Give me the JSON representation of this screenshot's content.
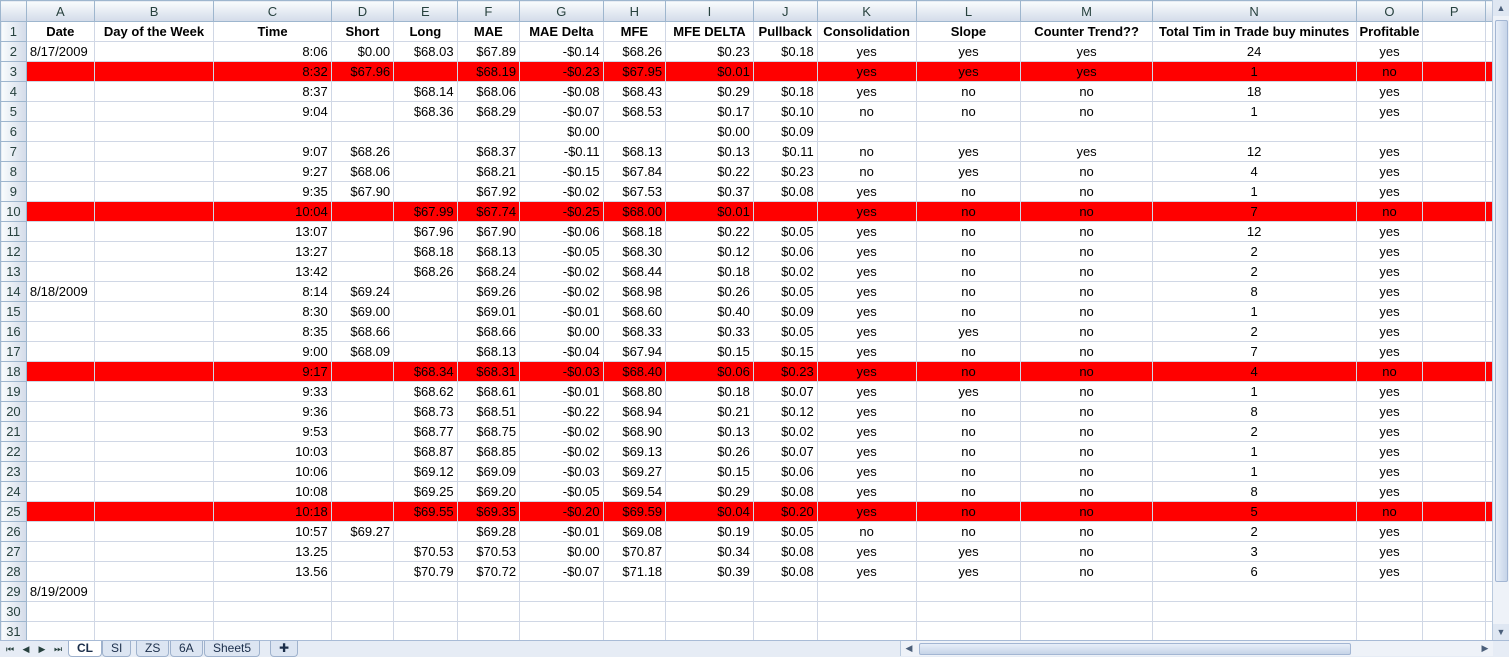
{
  "columns": [
    "A",
    "B",
    "C",
    "D",
    "E",
    "F",
    "G",
    "H",
    "I",
    "J",
    "K",
    "L",
    "M",
    "N",
    "O",
    "P"
  ],
  "rows": [
    {
      "n": "1",
      "hl": false,
      "cells": [
        "Date",
        "Day of the Week",
        "Time",
        "Short",
        "Long",
        "MAE",
        "MAE Delta",
        "MFE",
        "MFE DELTA",
        "Pullback",
        "Consolidation",
        "Slope",
        "Counter Trend??",
        "Total Tim in Trade buy minutes",
        "Profitable",
        ""
      ]
    },
    {
      "n": "2",
      "hl": false,
      "cells": [
        "8/17/2009",
        "",
        "8:06",
        "$0.00",
        "$68.03",
        "$67.89",
        "-$0.14",
        "$68.26",
        "$0.23",
        "$0.18",
        "yes",
        "yes",
        "yes",
        "24",
        "yes",
        ""
      ]
    },
    {
      "n": "3",
      "hl": true,
      "cells": [
        "",
        "",
        "8:32",
        "$67.96",
        "",
        "$68.19",
        "-$0.23",
        "$67.95",
        "$0.01",
        "",
        "yes",
        "yes",
        "yes",
        "1",
        "no",
        ""
      ]
    },
    {
      "n": "4",
      "hl": false,
      "cells": [
        "",
        "",
        "8:37",
        "",
        "$68.14",
        "$68.06",
        "-$0.08",
        "$68.43",
        "$0.29",
        "$0.18",
        "yes",
        "no",
        "no",
        "18",
        "yes",
        ""
      ]
    },
    {
      "n": "5",
      "hl": false,
      "cells": [
        "",
        "",
        "9:04",
        "",
        "$68.36",
        "$68.29",
        "-$0.07",
        "$68.53",
        "$0.17",
        "$0.10",
        "no",
        "no",
        "no",
        "1",
        "yes",
        ""
      ]
    },
    {
      "n": "6",
      "hl": false,
      "cells": [
        "",
        "",
        "",
        "",
        "",
        "",
        "$0.00",
        "",
        "$0.00",
        "$0.09",
        "",
        "",
        "",
        "",
        "",
        ""
      ]
    },
    {
      "n": "7",
      "hl": false,
      "cells": [
        "",
        "",
        "9:07",
        "$68.26",
        "",
        "$68.37",
        "-$0.11",
        "$68.13",
        "$0.13",
        "$0.11",
        "no",
        "yes",
        "yes",
        "12",
        "yes",
        ""
      ]
    },
    {
      "n": "8",
      "hl": false,
      "cells": [
        "",
        "",
        "9:27",
        "$68.06",
        "",
        "$68.21",
        "-$0.15",
        "$67.84",
        "$0.22",
        "$0.23",
        "no",
        "yes",
        "no",
        "4",
        "yes",
        ""
      ]
    },
    {
      "n": "9",
      "hl": false,
      "cells": [
        "",
        "",
        "9:35",
        "$67.90",
        "",
        "$67.92",
        "-$0.02",
        "$67.53",
        "$0.37",
        "$0.08",
        "yes",
        "no",
        "no",
        "1",
        "yes",
        ""
      ]
    },
    {
      "n": "10",
      "hl": true,
      "cells": [
        "",
        "",
        "10:04",
        "",
        "$67.99",
        "$67.74",
        "-$0.25",
        "$68.00",
        "$0.01",
        "",
        "yes",
        "no",
        "no",
        "7",
        "no",
        ""
      ]
    },
    {
      "n": "11",
      "hl": false,
      "cells": [
        "",
        "",
        "13:07",
        "",
        "$67.96",
        "$67.90",
        "-$0.06",
        "$68.18",
        "$0.22",
        "$0.05",
        "yes",
        "no",
        "no",
        "12",
        "yes",
        ""
      ]
    },
    {
      "n": "12",
      "hl": false,
      "cells": [
        "",
        "",
        "13:27",
        "",
        "$68.18",
        "$68.13",
        "-$0.05",
        "$68.30",
        "$0.12",
        "$0.06",
        "yes",
        "no",
        "no",
        "2",
        "yes",
        ""
      ]
    },
    {
      "n": "13",
      "hl": false,
      "cells": [
        "",
        "",
        "13:42",
        "",
        "$68.26",
        "$68.24",
        "-$0.02",
        "$68.44",
        "$0.18",
        "$0.02",
        "yes",
        "no",
        "no",
        "2",
        "yes",
        ""
      ]
    },
    {
      "n": "14",
      "hl": false,
      "cells": [
        "8/18/2009",
        "",
        "8:14",
        "$69.24",
        "",
        "$69.26",
        "-$0.02",
        "$68.98",
        "$0.26",
        "$0.05",
        "yes",
        "no",
        "no",
        "8",
        "yes",
        ""
      ]
    },
    {
      "n": "15",
      "hl": false,
      "cells": [
        "",
        "",
        "8:30",
        "$69.00",
        "",
        "$69.01",
        "-$0.01",
        "$68.60",
        "$0.40",
        "$0.09",
        "yes",
        "no",
        "no",
        "1",
        "yes",
        ""
      ]
    },
    {
      "n": "16",
      "hl": false,
      "cells": [
        "",
        "",
        "8:35",
        "$68.66",
        "",
        "$68.66",
        "$0.00",
        "$68.33",
        "$0.33",
        "$0.05",
        "yes",
        "yes",
        "no",
        "2",
        "yes",
        ""
      ]
    },
    {
      "n": "17",
      "hl": false,
      "cells": [
        "",
        "",
        "9:00",
        "$68.09",
        "",
        "$68.13",
        "-$0.04",
        "$67.94",
        "$0.15",
        "$0.15",
        "yes",
        "no",
        "no",
        "7",
        "yes",
        ""
      ]
    },
    {
      "n": "18",
      "hl": true,
      "cells": [
        "",
        "",
        "9:17",
        "",
        "$68.34",
        "$68.31",
        "-$0.03",
        "$68.40",
        "$0.06",
        "$0.23",
        "yes",
        "no",
        "no",
        "4",
        "no",
        ""
      ]
    },
    {
      "n": "19",
      "hl": false,
      "cells": [
        "",
        "",
        "9:33",
        "",
        "$68.62",
        "$68.61",
        "-$0.01",
        "$68.80",
        "$0.18",
        "$0.07",
        "yes",
        "yes",
        "no",
        "1",
        "yes",
        ""
      ]
    },
    {
      "n": "20",
      "hl": false,
      "cells": [
        "",
        "",
        "9:36",
        "",
        "$68.73",
        "$68.51",
        "-$0.22",
        "$68.94",
        "$0.21",
        "$0.12",
        "yes",
        "no",
        "no",
        "8",
        "yes",
        ""
      ]
    },
    {
      "n": "21",
      "hl": false,
      "cells": [
        "",
        "",
        "9:53",
        "",
        "$68.77",
        "$68.75",
        "-$0.02",
        "$68.90",
        "$0.13",
        "$0.02",
        "yes",
        "no",
        "no",
        "2",
        "yes",
        ""
      ]
    },
    {
      "n": "22",
      "hl": false,
      "cells": [
        "",
        "",
        "10:03",
        "",
        "$68.87",
        "$68.85",
        "-$0.02",
        "$69.13",
        "$0.26",
        "$0.07",
        "yes",
        "no",
        "no",
        "1",
        "yes",
        ""
      ]
    },
    {
      "n": "23",
      "hl": false,
      "cells": [
        "",
        "",
        "10:06",
        "",
        "$69.12",
        "$69.09",
        "-$0.03",
        "$69.27",
        "$0.15",
        "$0.06",
        "yes",
        "no",
        "no",
        "1",
        "yes",
        ""
      ]
    },
    {
      "n": "24",
      "hl": false,
      "cells": [
        "",
        "",
        "10:08",
        "",
        "$69.25",
        "$69.20",
        "-$0.05",
        "$69.54",
        "$0.29",
        "$0.08",
        "yes",
        "no",
        "no",
        "8",
        "yes",
        ""
      ]
    },
    {
      "n": "25",
      "hl": true,
      "cells": [
        "",
        "",
        "10:18",
        "",
        "$69.55",
        "$69.35",
        "-$0.20",
        "$69.59",
        "$0.04",
        "$0.20",
        "yes",
        "no",
        "no",
        "5",
        "no",
        ""
      ]
    },
    {
      "n": "26",
      "hl": false,
      "cells": [
        "",
        "",
        "10:57",
        "$69.27",
        "",
        "$69.28",
        "-$0.01",
        "$69.08",
        "$0.19",
        "$0.05",
        "no",
        "no",
        "no",
        "2",
        "yes",
        ""
      ]
    },
    {
      "n": "27",
      "hl": false,
      "cells": [
        "",
        "",
        "13.25",
        "",
        "$70.53",
        "$70.53",
        "$0.00",
        "$70.87",
        "$0.34",
        "$0.08",
        "yes",
        "yes",
        "no",
        "3",
        "yes",
        ""
      ]
    },
    {
      "n": "28",
      "hl": false,
      "cells": [
        "",
        "",
        "13.56",
        "",
        "$70.79",
        "$70.72",
        "-$0.07",
        "$71.18",
        "$0.39",
        "$0.08",
        "yes",
        "yes",
        "no",
        "6",
        "yes",
        ""
      ]
    },
    {
      "n": "29",
      "hl": false,
      "cells": [
        "8/19/2009",
        "",
        "",
        "",
        "",
        "",
        "",
        "",
        "",
        "",
        "",
        "",
        "",
        "",
        "",
        ""
      ]
    },
    {
      "n": "30",
      "hl": false,
      "cells": [
        "",
        "",
        "",
        "",
        "",
        "",
        "",
        "",
        "",
        "",
        "",
        "",
        "",
        "",
        "",
        ""
      ]
    },
    {
      "n": "31",
      "hl": false,
      "cells": [
        "",
        "",
        "",
        "",
        "",
        "",
        "",
        "",
        "",
        "",
        "",
        "",
        "",
        "",
        "",
        ""
      ]
    }
  ],
  "sheet_tabs": [
    "CL",
    "SI",
    "ZS",
    "6A",
    "Sheet5"
  ],
  "active_tab": "CL",
  "colors": {
    "highlight_row": "#ff0000",
    "header_bg": "#d3dbe9",
    "gridline": "#d0d7e5"
  },
  "icons": {
    "nav_first": "first-sheet-icon",
    "nav_prev": "prev-sheet-icon",
    "nav_next": "next-sheet-icon",
    "nav_last": "last-sheet-icon",
    "new_sheet": "insert-sheet-icon"
  }
}
